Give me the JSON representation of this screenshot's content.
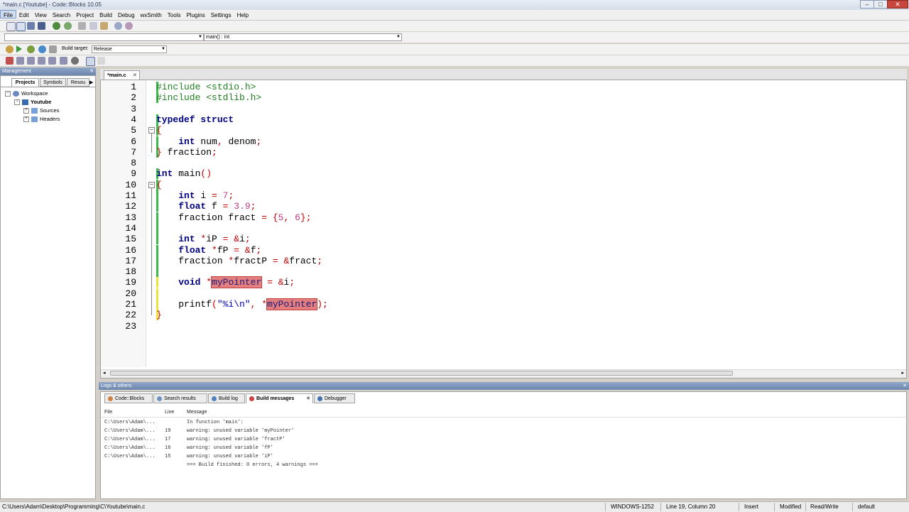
{
  "window": {
    "title": "*main.c [Youtube] - Code::Blocks 10.05"
  },
  "menu": [
    "File",
    "Edit",
    "View",
    "Search",
    "Project",
    "Build",
    "Debug",
    "wxSmith",
    "Tools",
    "Plugins",
    "Settings",
    "Help"
  ],
  "toolbar": {
    "scope_combo": "",
    "function_combo": "main() : int",
    "build_target_label": "Build target:",
    "build_target_value": "Release"
  },
  "management": {
    "title": "Management",
    "tabs": [
      "Projects",
      "Symbols",
      "Resou"
    ],
    "tree": {
      "workspace": "Workspace",
      "project": "Youtube",
      "folders": [
        "Sources",
        "Headers"
      ]
    }
  },
  "editor": {
    "tab": "*main.c",
    "lines": [
      {
        "n": "1",
        "text": "#include <stdio.h>"
      },
      {
        "n": "2",
        "text": "#include <stdlib.h>"
      },
      {
        "n": "3",
        "text": ""
      },
      {
        "n": "4",
        "text": "typedef struct"
      },
      {
        "n": "5",
        "text": "{"
      },
      {
        "n": "6",
        "text": "    int num, denom;"
      },
      {
        "n": "7",
        "text": "} fraction;"
      },
      {
        "n": "8",
        "text": ""
      },
      {
        "n": "9",
        "text": "int main()"
      },
      {
        "n": "10",
        "text": "{"
      },
      {
        "n": "11",
        "text": "    int i = 7;"
      },
      {
        "n": "12",
        "text": "    float f = 3.9;"
      },
      {
        "n": "13",
        "text": "    fraction fract = {5, 6};"
      },
      {
        "n": "14",
        "text": ""
      },
      {
        "n": "15",
        "text": "    int *iP = &i;"
      },
      {
        "n": "16",
        "text": "    float *fP = &f;"
      },
      {
        "n": "17",
        "text": "    fraction *fractP = &fract;"
      },
      {
        "n": "18",
        "text": ""
      },
      {
        "n": "19",
        "text": "    void *myPointer = &i;"
      },
      {
        "n": "20",
        "text": ""
      },
      {
        "n": "21",
        "text": "    printf(\"%i\\n\", *myPointer);"
      },
      {
        "n": "22",
        "text": "}"
      },
      {
        "n": "23",
        "text": ""
      }
    ]
  },
  "logs": {
    "title": "Logs & others",
    "tabs": [
      "Code::Blocks",
      "Search results",
      "Build log",
      "Build messages",
      "Debugger"
    ],
    "columns": [
      "File",
      "Line",
      "Message"
    ],
    "rows": [
      {
        "file": "C:\\Users\\Adam\\...",
        "line": "",
        "message": "In function 'main':"
      },
      {
        "file": "C:\\Users\\Adam\\...",
        "line": "19",
        "message": "warning: unused variable 'myPointer'"
      },
      {
        "file": "C:\\Users\\Adam\\...",
        "line": "17",
        "message": "warning: unused variable 'fractP'"
      },
      {
        "file": "C:\\Users\\Adam\\...",
        "line": "16",
        "message": "warning: unused variable 'fP'"
      },
      {
        "file": "C:\\Users\\Adam\\...",
        "line": "15",
        "message": "warning: unused variable 'iP'"
      },
      {
        "file": "",
        "line": "",
        "message": "=== Build finished: 0 errors, 4 warnings ==="
      }
    ]
  },
  "status": {
    "path": "C:\\Users\\Adam\\Desktop\\Programming\\C\\Youtube\\main.c",
    "encoding": "WINDOWS-1252",
    "position": "Line 19, Column 20",
    "mode": "Insert",
    "modified": "Modified",
    "access": "Read/Write",
    "profile": "default"
  },
  "colors": {
    "accent": "#6d86ad",
    "change_bar": "#3cb84c",
    "highlight": "#e57e7e"
  },
  "icons": [
    "new-file-icon",
    "open-icon",
    "save-icon",
    "save-all-icon",
    "undo-icon",
    "redo-icon",
    "cut-icon",
    "copy-icon",
    "paste-icon",
    "find-icon",
    "replace-icon",
    "build-icon",
    "run-icon",
    "build-run-icon",
    "rebuild-icon",
    "stop-icon",
    "debug-icon"
  ]
}
